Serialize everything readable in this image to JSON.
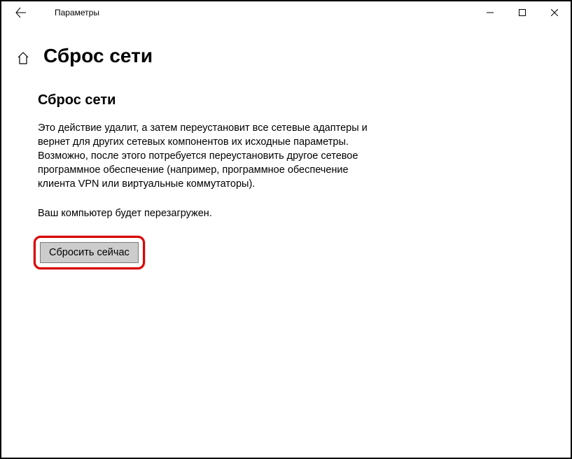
{
  "window": {
    "title": "Параметры"
  },
  "page": {
    "title": "Сброс сети",
    "section_title": "Сброс сети",
    "description": "Это действие удалит, а затем переустановит все сетевые адаптеры и вернет для других сетевых компонентов их исходные параметры. Возможно, после этого потребуется переустановить другое сетевое программное обеспечение (например, программное обеспечение клиента VPN или виртуальные коммутаторы).",
    "reboot_note": "Ваш компьютер будет перезагружен.",
    "reset_button": "Сбросить сейчас"
  }
}
